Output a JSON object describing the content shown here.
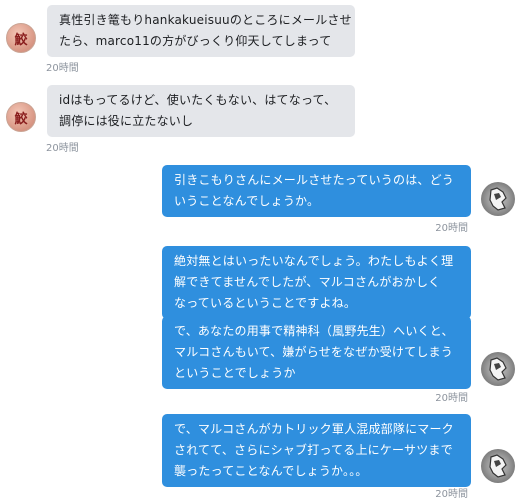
{
  "messages": [
    {
      "side": "in",
      "lines": [
        "真性引き篭もりhankakueisuuのところにメールさせ",
        "たら、marco11の方がびっくり仰天してしまって"
      ],
      "time": "20時間"
    },
    {
      "side": "in",
      "lines": [
        "idはもってるけど、使いたくもない、はてなって、",
        "調停には役に立たないし"
      ],
      "time": "20時間"
    },
    {
      "side": "out",
      "lines": [
        "引きこもりさんにメールさせたっていうのは、どう",
        "いうことなんでしょうか。"
      ],
      "time": "20時間"
    },
    {
      "side": "out",
      "lines": [
        "絶対無とはいったいなんでしょう。わたしもよく理",
        "解できてませんでしたが、マルコさんがおかしく",
        "なっているということですよね。"
      ]
    },
    {
      "side": "out",
      "lines": [
        "で、あなたの用事で精神科（風野先生）へいくと、",
        "マルコさんもいて、嫌がらせをなぜか受けてしまう",
        "ということでしょうか"
      ],
      "time": "20時間"
    },
    {
      "side": "out",
      "lines": [
        "で、マルコさんがカトリック軍人混成部隊にマーク",
        "されてて、さらにシャブ打ってる上にケーサツまで",
        "襲ったってことなんでしょうか。。。"
      ],
      "time": "20時間"
    }
  ],
  "avatar_left_glyph": "鮫",
  "avatar_icons": {
    "incoming": "user-avatar-icon",
    "outgoing": "user-avatar-icon"
  }
}
